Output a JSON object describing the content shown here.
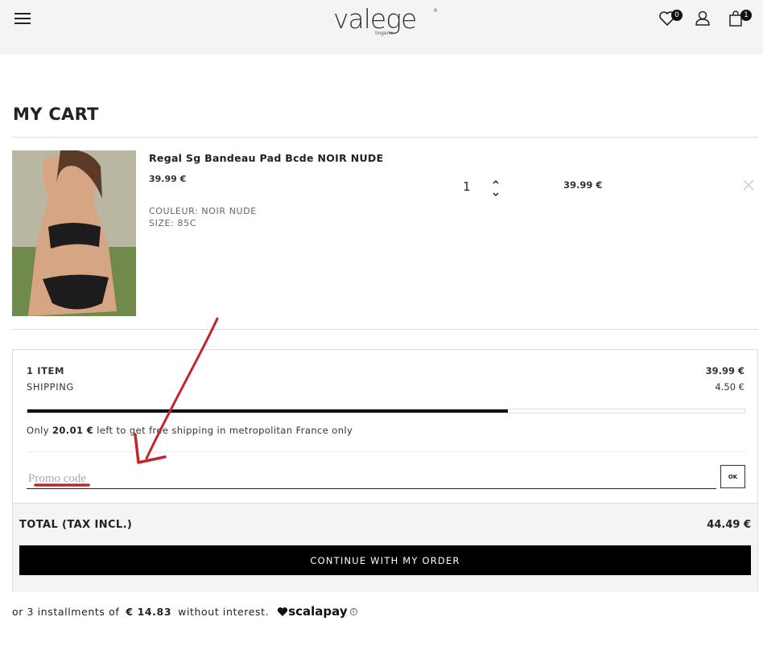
{
  "header": {
    "logo_text": "valege",
    "logo_sub": "lingerie",
    "logo_reg": "®",
    "wishlist_count": "0",
    "cart_count": "1"
  },
  "page": {
    "title": "MY CART"
  },
  "cart_item": {
    "name": "Regal Sg Bandeau Pad Bcde NOIR NUDE",
    "unit_price": "39.99 €",
    "color_line": "COULEUR: NOIR NUDE",
    "size_line": "SIZE: 85C",
    "quantity": "1",
    "line_total": "39.99 €"
  },
  "summary": {
    "items_label": "1 ITEM",
    "items_value": "39.99 €",
    "shipping_label": "SHIPPING",
    "shipping_value": "4.50 €",
    "free_shipping_progress": 0.67,
    "ship_msg_prefix": "Only ",
    "ship_msg_amount": "20.01 €",
    "ship_msg_suffix": " left to get free shipping in metropolitan France only",
    "promo_placeholder": "Promo code",
    "ok_label": "OK",
    "total_label": "TOTAL (TAX INCL.)",
    "total_value": "44.49 €",
    "cta_label": "CONTINUE WITH MY ORDER"
  },
  "installments": {
    "prefix": "or 3 installments of",
    "amount": "€ 14.83",
    "suffix": "without interest.",
    "brand": "scalapay",
    "info": "i"
  },
  "colors": {
    "accent": "#000000",
    "header_bg": "#f4f4f4",
    "annotation": "#c0272d"
  }
}
